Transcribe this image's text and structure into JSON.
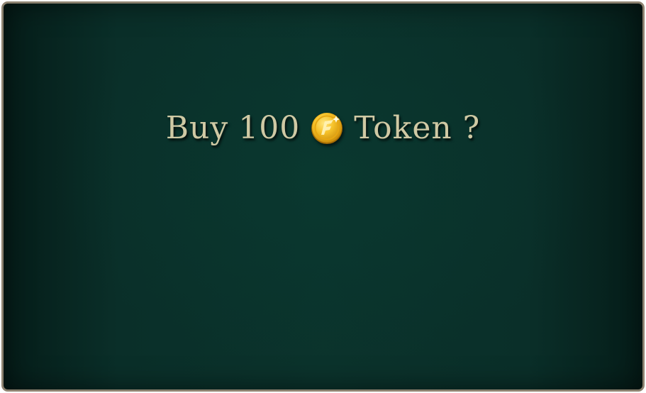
{
  "dialog": {
    "prompt": {
      "buy_label": "Buy",
      "amount": "100",
      "currency_label": "Token ?",
      "coin_icon": "gold-token-coin-icon"
    }
  },
  "colors": {
    "background": "#0b332c",
    "border": "#8d8270",
    "text": "#cfc9a4",
    "coin": "#f2b51c"
  }
}
